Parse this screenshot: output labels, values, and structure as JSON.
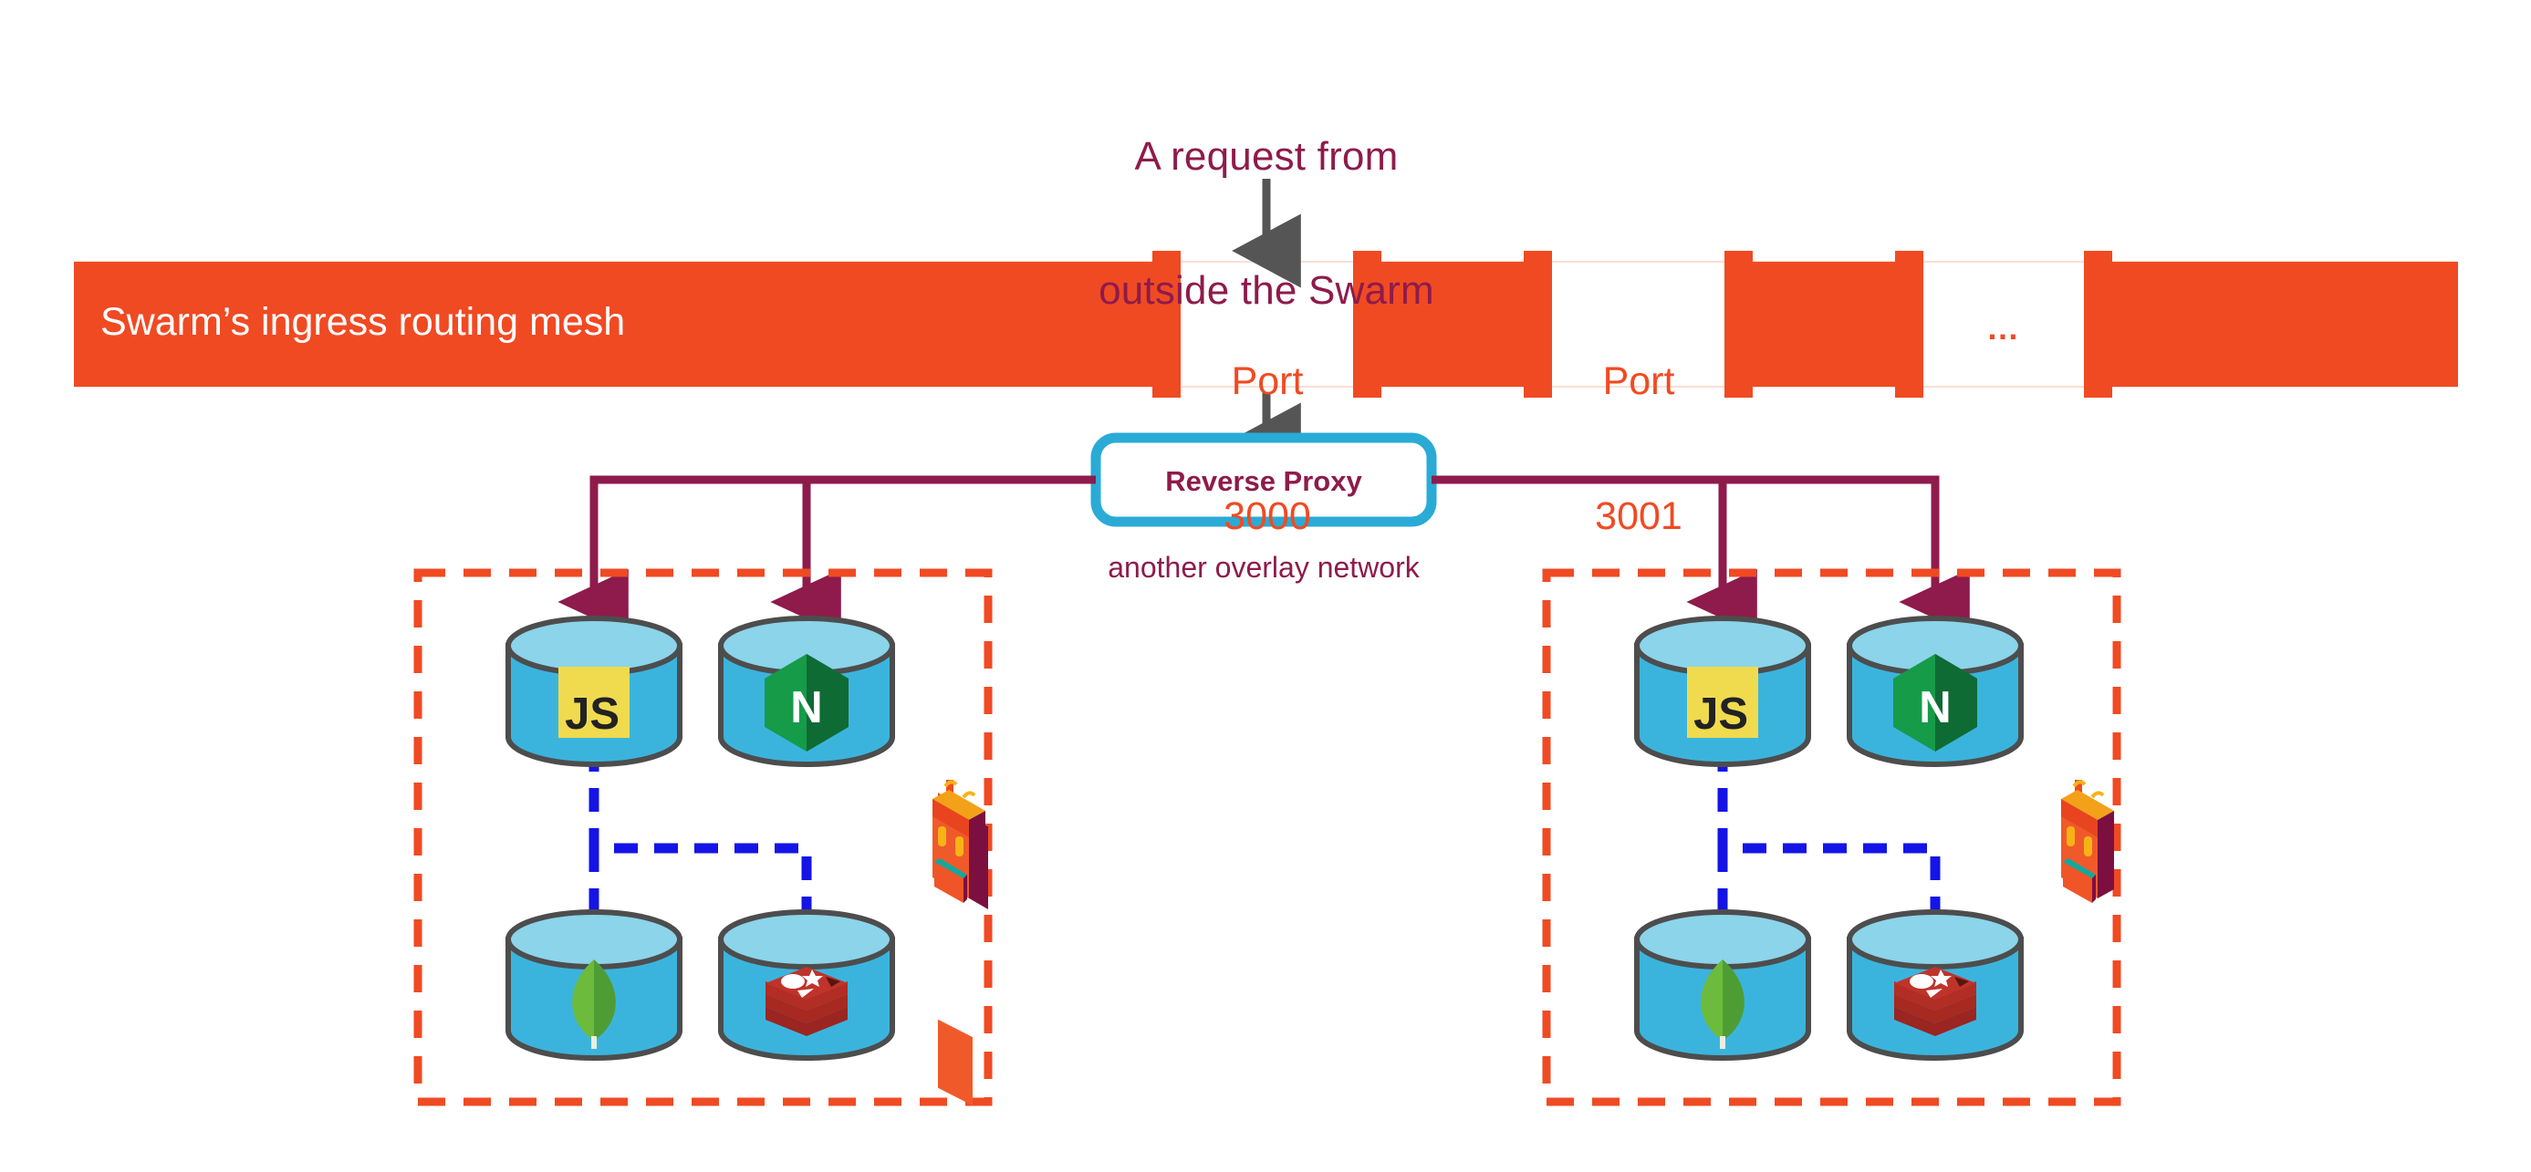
{
  "diagram": {
    "title_lines": [
      "A request from",
      "outside the Swarm"
    ],
    "mesh_bar_label": "Swarm’s ingress routing mesh",
    "ports": [
      {
        "name": "port-3000",
        "line1": "Port",
        "line2": "3000"
      },
      {
        "name": "port-3001",
        "line1": "Port",
        "line2": "3001"
      },
      {
        "name": "port-more",
        "line1": "…",
        "line2": ""
      }
    ],
    "ellipsis": "…",
    "reverse_proxy_label": "Reverse Proxy",
    "overlay_network_label": "another overlay network",
    "clusters": [
      {
        "name": "stack-left",
        "services": [
          {
            "name": "service-nodejs",
            "icon": "js-icon",
            "label": "JS"
          },
          {
            "name": "service-nginx",
            "icon": "nginx-icon",
            "label": "N"
          },
          {
            "name": "service-mongodb",
            "icon": "mongodb-leaf-icon",
            "label": ""
          },
          {
            "name": "service-redis",
            "icon": "redis-icon",
            "label": ""
          }
        ],
        "bundle_icon": "backpack-icon"
      },
      {
        "name": "stack-right",
        "services": [
          {
            "name": "service-nodejs",
            "icon": "js-icon",
            "label": "JS"
          },
          {
            "name": "service-nginx",
            "icon": "nginx-icon",
            "label": "N"
          },
          {
            "name": "service-mongodb",
            "icon": "mongodb-leaf-icon",
            "label": ""
          },
          {
            "name": "service-redis",
            "icon": "redis-icon",
            "label": ""
          }
        ],
        "bundle_icon": "backpack-icon"
      }
    ],
    "colors": {
      "orange": "#F04A23",
      "maroon": "#8E1B4B",
      "cyan": "#29ABD6",
      "cylinder_body": "#3BB4DD",
      "cylinder_top": "#8BD4EA",
      "cylinder_stroke": "#4D4D4D",
      "blue_dash": "#1414E6",
      "gray_arrow": "#555555",
      "js_yellow": "#F0DB4F",
      "nginx_green": "#169B49",
      "nginx_green_dark": "#0E6B33",
      "mongo_green": "#5FA93C",
      "redis_red": "#C0332B",
      "white": "#FFFFFF"
    }
  }
}
